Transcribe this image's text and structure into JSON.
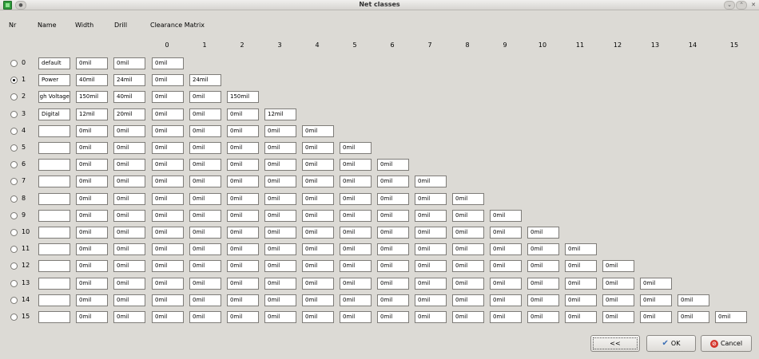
{
  "window": {
    "title": "Net classes",
    "menu_icon": "circle-menu-icon",
    "buttons": [
      "chevron-down-icon",
      "chevron-up-icon",
      "close-icon"
    ]
  },
  "headers": {
    "nr": "Nr",
    "name": "Name",
    "width": "Width",
    "drill": "Drill",
    "clearance": "Clearance Matrix"
  },
  "matrix_columns": [
    "0",
    "1",
    "2",
    "3",
    "4",
    "5",
    "6",
    "7",
    "8",
    "9",
    "10",
    "11",
    "12",
    "13",
    "14",
    "15"
  ],
  "selected_row": 1,
  "rows": [
    {
      "nr": "0",
      "name": "default",
      "width": "0mil",
      "drill": "0mil",
      "clearance": [
        "0mil"
      ]
    },
    {
      "nr": "1",
      "name": "Power",
      "width": "40mil",
      "drill": "24mil",
      "clearance": [
        "0mil",
        "24mil"
      ]
    },
    {
      "nr": "2",
      "name": "High Voltage",
      "width": "150mil",
      "drill": "40mil",
      "clearance": [
        "0mil",
        "0mil",
        "150mil"
      ]
    },
    {
      "nr": "3",
      "name": "Digital",
      "width": "12mil",
      "drill": "20mil",
      "clearance": [
        "0mil",
        "0mil",
        "0mil",
        "12mil"
      ]
    },
    {
      "nr": "4",
      "name": "",
      "width": "0mil",
      "drill": "0mil",
      "clearance": [
        "0mil",
        "0mil",
        "0mil",
        "0mil",
        "0mil"
      ]
    },
    {
      "nr": "5",
      "name": "",
      "width": "0mil",
      "drill": "0mil",
      "clearance": [
        "0mil",
        "0mil",
        "0mil",
        "0mil",
        "0mil",
        "0mil"
      ]
    },
    {
      "nr": "6",
      "name": "",
      "width": "0mil",
      "drill": "0mil",
      "clearance": [
        "0mil",
        "0mil",
        "0mil",
        "0mil",
        "0mil",
        "0mil",
        "0mil"
      ]
    },
    {
      "nr": "7",
      "name": "",
      "width": "0mil",
      "drill": "0mil",
      "clearance": [
        "0mil",
        "0mil",
        "0mil",
        "0mil",
        "0mil",
        "0mil",
        "0mil",
        "0mil"
      ]
    },
    {
      "nr": "8",
      "name": "",
      "width": "0mil",
      "drill": "0mil",
      "clearance": [
        "0mil",
        "0mil",
        "0mil",
        "0mil",
        "0mil",
        "0mil",
        "0mil",
        "0mil",
        "0mil"
      ]
    },
    {
      "nr": "9",
      "name": "",
      "width": "0mil",
      "drill": "0mil",
      "clearance": [
        "0mil",
        "0mil",
        "0mil",
        "0mil",
        "0mil",
        "0mil",
        "0mil",
        "0mil",
        "0mil",
        "0mil"
      ]
    },
    {
      "nr": "10",
      "name": "",
      "width": "0mil",
      "drill": "0mil",
      "clearance": [
        "0mil",
        "0mil",
        "0mil",
        "0mil",
        "0mil",
        "0mil",
        "0mil",
        "0mil",
        "0mil",
        "0mil",
        "0mil"
      ]
    },
    {
      "nr": "11",
      "name": "",
      "width": "0mil",
      "drill": "0mil",
      "clearance": [
        "0mil",
        "0mil",
        "0mil",
        "0mil",
        "0mil",
        "0mil",
        "0mil",
        "0mil",
        "0mil",
        "0mil",
        "0mil",
        "0mil"
      ]
    },
    {
      "nr": "12",
      "name": "",
      "width": "0mil",
      "drill": "0mil",
      "clearance": [
        "0mil",
        "0mil",
        "0mil",
        "0mil",
        "0mil",
        "0mil",
        "0mil",
        "0mil",
        "0mil",
        "0mil",
        "0mil",
        "0mil",
        "0mil"
      ]
    },
    {
      "nr": "13",
      "name": "",
      "width": "0mil",
      "drill": "0mil",
      "clearance": [
        "0mil",
        "0mil",
        "0mil",
        "0mil",
        "0mil",
        "0mil",
        "0mil",
        "0mil",
        "0mil",
        "0mil",
        "0mil",
        "0mil",
        "0mil",
        "0mil"
      ]
    },
    {
      "nr": "14",
      "name": "",
      "width": "0mil",
      "drill": "0mil",
      "clearance": [
        "0mil",
        "0mil",
        "0mil",
        "0mil",
        "0mil",
        "0mil",
        "0mil",
        "0mil",
        "0mil",
        "0mil",
        "0mil",
        "0mil",
        "0mil",
        "0mil",
        "0mil"
      ]
    },
    {
      "nr": "15",
      "name": "",
      "width": "0mil",
      "drill": "0mil",
      "clearance": [
        "0mil",
        "0mil",
        "0mil",
        "0mil",
        "0mil",
        "0mil",
        "0mil",
        "0mil",
        "0mil",
        "0mil",
        "0mil",
        "0mil",
        "0mil",
        "0mil",
        "0mil",
        "0mil"
      ]
    }
  ],
  "buttons": {
    "back": "<<",
    "ok": "OK",
    "ok_icon": "checkmark-icon",
    "cancel": "Cancel",
    "cancel_icon": "cancel-icon"
  },
  "colors": {
    "background": "#dcdad5",
    "field_border": "#7e7c78",
    "ok_icon": "#3c6fb5",
    "cancel_icon": "#d4352b"
  }
}
